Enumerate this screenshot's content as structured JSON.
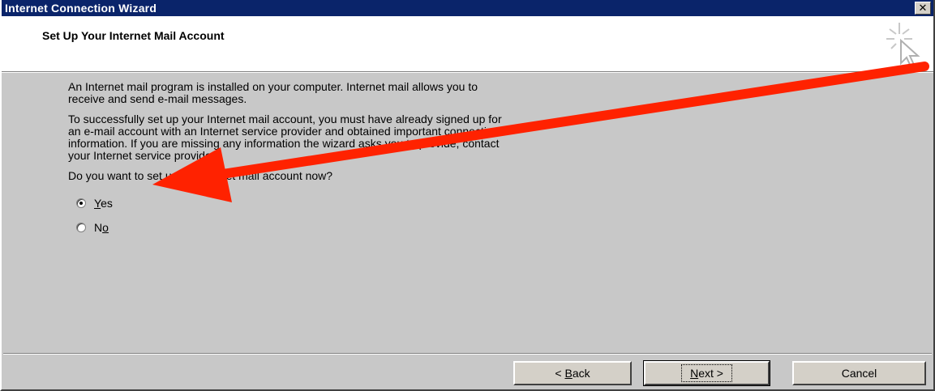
{
  "window": {
    "title": "Internet Connection Wizard",
    "close_icon": "close-icon"
  },
  "header": {
    "title": "Set Up Your Internet Mail Account",
    "icon": "wizard-sparkle-cursor-icon"
  },
  "content": {
    "para1": "An Internet mail program is installed on your computer. Internet mail allows you to\nreceive and send e-mail messages.",
    "para2": "To successfully set up your Internet mail account, you must have already signed up for\nan e-mail account with an Internet service provider and obtained important connection\ninformation. If you are missing any information the wizard asks you to provide, contact\nyour Internet service provider.",
    "question": "Do you want to set up an Internet mail account now?"
  },
  "options": {
    "yes_label": "Yes",
    "no_label": "No",
    "selected": "Yes"
  },
  "buttons": {
    "back": "< Back",
    "next": "Next >",
    "cancel": "Cancel"
  },
  "annotation": {
    "arrow_color": "#ff2200"
  }
}
